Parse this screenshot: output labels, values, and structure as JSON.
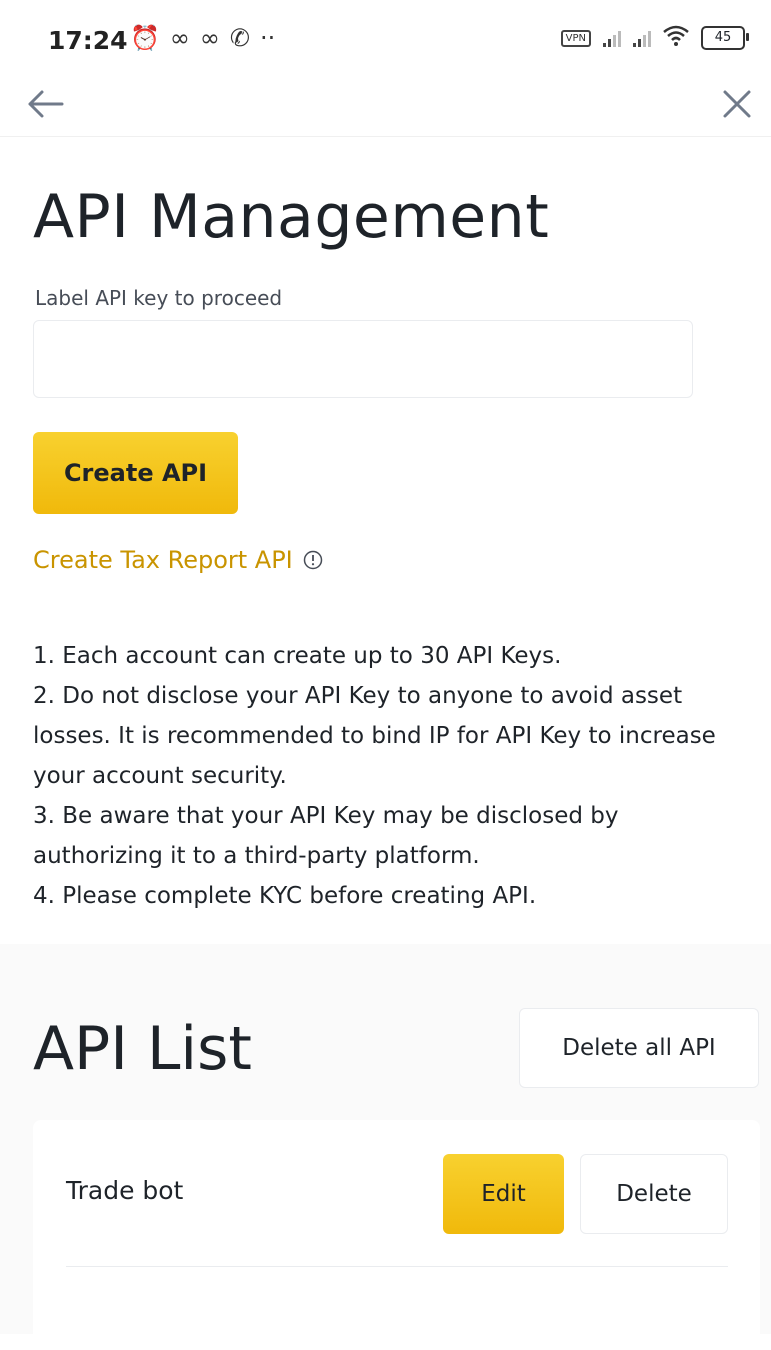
{
  "status_bar": {
    "time": "17:24",
    "vpn_label": "VPN",
    "battery": "45",
    "left_icons": [
      "alarm-icon",
      "app-icon",
      "app-icon",
      "whatsapp-icon",
      "more-dots-icon"
    ],
    "right_icons": [
      "vpn-icon",
      "signal-icon",
      "signal-icon",
      "wifi-icon",
      "battery-icon"
    ]
  },
  "nav": {
    "back_icon": "back-arrow-icon",
    "close_icon": "close-icon"
  },
  "page": {
    "title": "API Management",
    "field_label": "Label API key to proceed",
    "input_value": "",
    "create_button": "Create API",
    "tax_link": "Create Tax Report API",
    "info_icon": "info-icon"
  },
  "notes": [
    "1. Each account can create up to 30 API Keys.",
    "2. Do not disclose your API Key to anyone to avoid asset losses. It is recommended to bind IP for API Key to increase your account security.",
    "3. Be aware that your API Key may be disclosed by authorizing it to a third-party platform.",
    "4. Please complete KYC before creating API."
  ],
  "api_list": {
    "title": "API List",
    "delete_all_button": "Delete all API",
    "items": [
      {
        "name": "Trade bot",
        "edit_label": "Edit",
        "delete_label": "Delete"
      }
    ]
  },
  "colors": {
    "accent": "#f0b90b",
    "link": "#c99400",
    "text": "#1e2329",
    "muted": "#474d57",
    "list_background": "#fafafa"
  }
}
